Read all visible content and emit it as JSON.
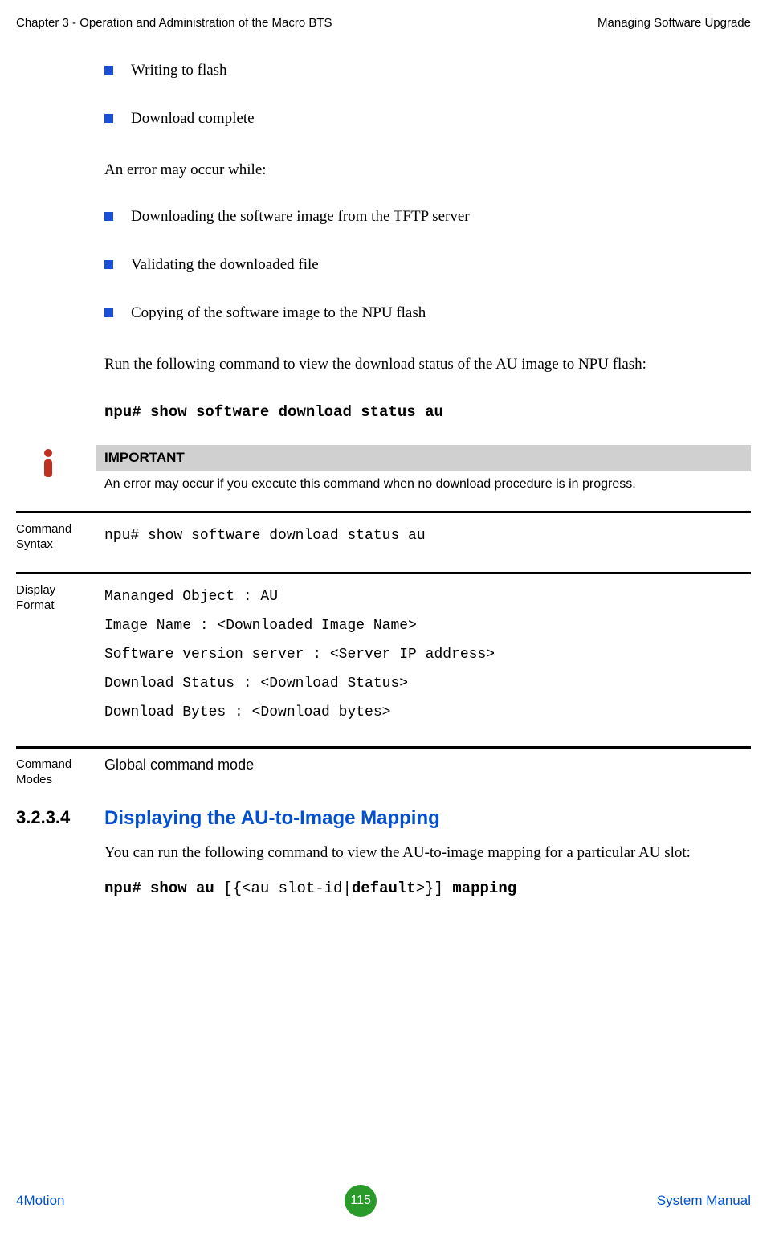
{
  "header": {
    "left": "Chapter 3 - Operation and Administration of the Macro BTS",
    "right": "Managing Software Upgrade"
  },
  "bullets_a": [
    "Writing to flash",
    "Download complete"
  ],
  "para_error": "An error may occur while:",
  "bullets_b": [
    "Downloading the software image from the TFTP server",
    "Validating the downloaded file",
    "Copying of the software image to the NPU flash"
  ],
  "para_run": "Run the following command to view the download status of the AU image to NPU flash:",
  "cmd_show": "npu# show software download status au",
  "important": {
    "title": "IMPORTANT",
    "text": "An error may occur if you execute this command when no download procedure is in progress."
  },
  "ref_syntax": {
    "label": "Command Syntax",
    "text": "npu# show software download status au"
  },
  "ref_display": {
    "label": "Display Format",
    "lines": [
      "Mananged Object         : AU",
      "Image Name              : <Downloaded Image Name>",
      "Software version server : <Server IP address>",
      "Download Status         : <Download Status>",
      "Download Bytes          : <Download bytes>"
    ]
  },
  "ref_modes": {
    "label": "Command Modes",
    "text": "Global command mode"
  },
  "section": {
    "num": "3.2.3.4",
    "title": "Displaying the AU-to-Image Mapping"
  },
  "para_mapping": "You can run the following command to view the AU-to-image mapping for a particular AU slot:",
  "cmd_mapping": {
    "p1": "npu# show au ",
    "p2": "[{<au slot-id|",
    "p3": "default",
    "p4": ">}] ",
    "p5": "mapping"
  },
  "footer": {
    "left": "4Motion",
    "page": "115",
    "right": "System Manual"
  }
}
